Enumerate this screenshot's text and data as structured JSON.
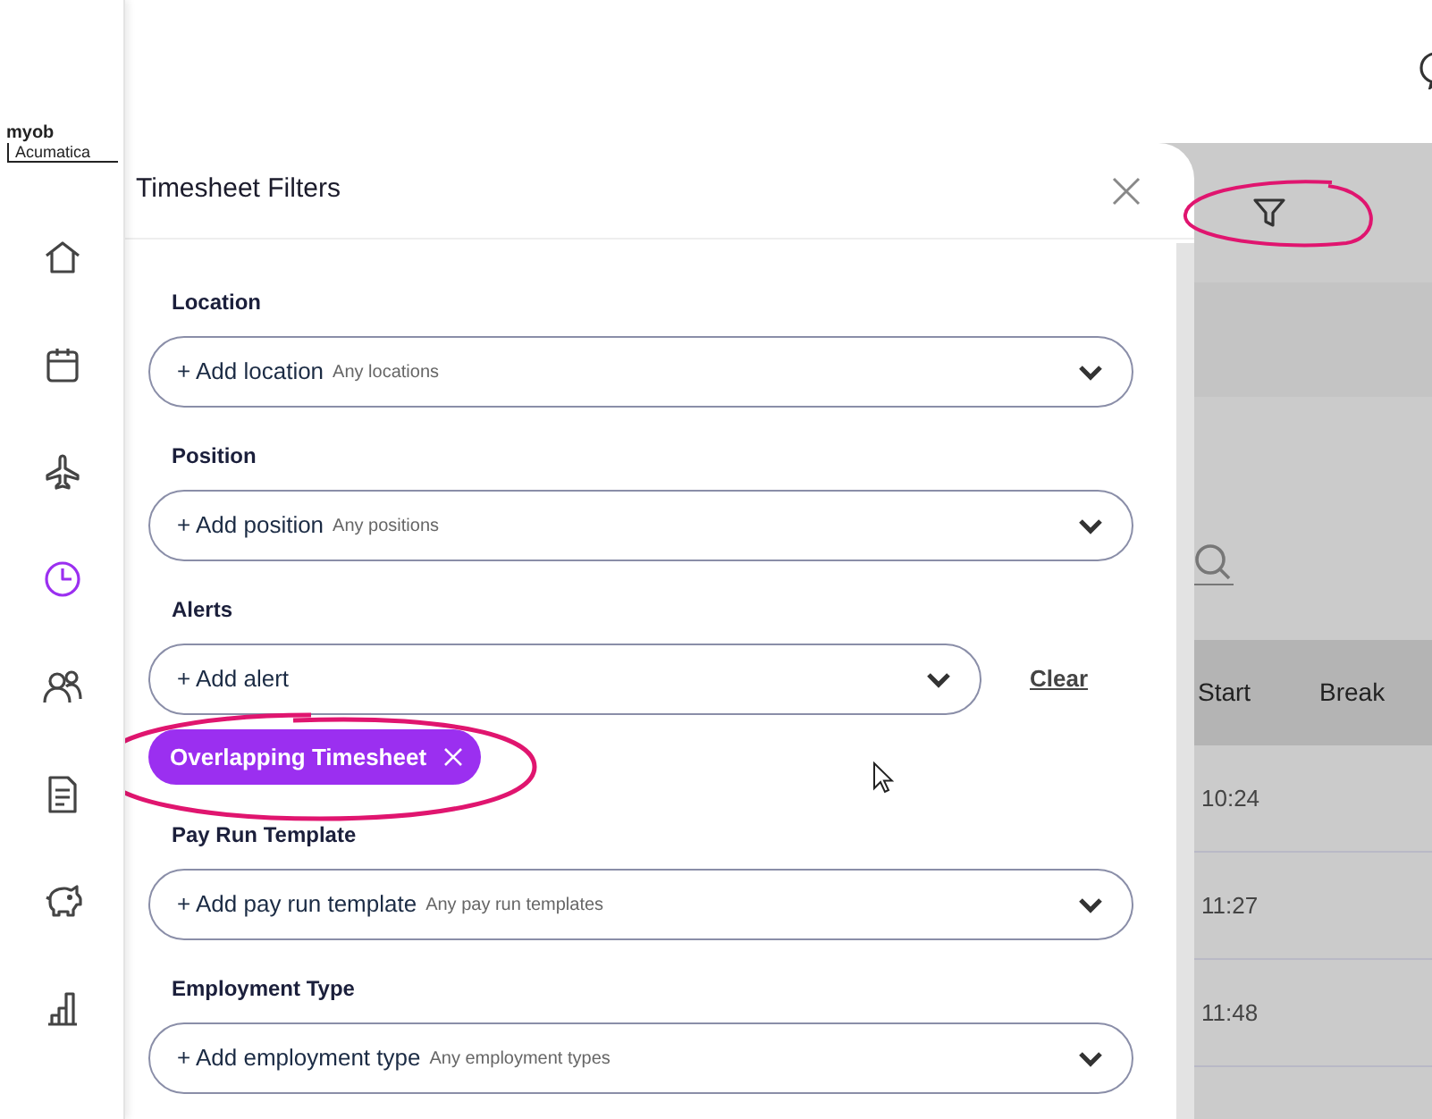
{
  "brand": {
    "line_1": "myob",
    "line_2": "Acumatica"
  },
  "sidebar": {
    "items": [
      {
        "kind": "home",
        "selected": false
      },
      {
        "kind": "calendar",
        "selected": false
      },
      {
        "kind": "plane",
        "selected": false
      },
      {
        "kind": "clock",
        "selected": true
      },
      {
        "kind": "people",
        "selected": false
      },
      {
        "kind": "document",
        "selected": false
      },
      {
        "kind": "piggy",
        "selected": false
      },
      {
        "kind": "chart",
        "selected": false
      }
    ]
  },
  "panel": {
    "title": "Timesheet Filters",
    "filters": [
      {
        "label": "Location",
        "add_text": "+ Add location",
        "hint": "Any locations"
      },
      {
        "label": "Position",
        "add_text": "+ Add position",
        "hint": "Any positions"
      },
      {
        "label": "Alerts",
        "add_text": "+ Add alert",
        "clear": "Clear",
        "chips": [
          "Overlapping Timesheet"
        ]
      },
      {
        "label": "Pay Run Template",
        "add_text": "+ Add pay run template",
        "hint": "Any pay run templates"
      },
      {
        "label": "Employment Type",
        "add_text": "+ Add employment type",
        "hint": "Any employment types"
      }
    ]
  },
  "table": {
    "columns": [
      "Start",
      "Break"
    ],
    "rows": [
      {
        "start": "10:24"
      },
      {
        "start": "11:27"
      },
      {
        "start": "11:48"
      }
    ]
  }
}
